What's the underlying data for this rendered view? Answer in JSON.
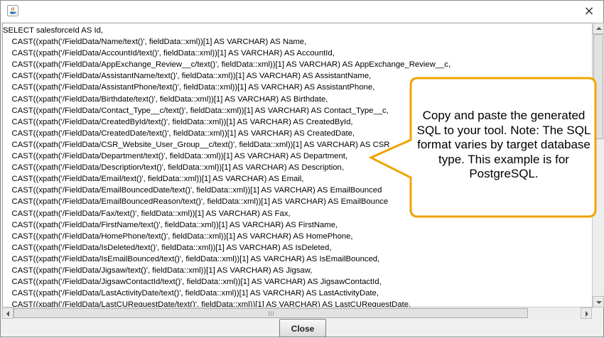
{
  "window": {
    "close_glyph": "×",
    "app_icon": "java-icon"
  },
  "editor": {
    "lines": [
      "SELECT salesforceId AS Id,",
      "    CAST((xpath('/FieldData/Name/text()', fieldData::xml))[1] AS VARCHAR) AS Name,",
      "    CAST((xpath('/FieldData/AccountId/text()', fieldData::xml))[1] AS VARCHAR) AS AccountId,",
      "    CAST((xpath('/FieldData/AppExchange_Review__c/text()', fieldData::xml))[1] AS VARCHAR) AS AppExchange_Review__c,",
      "    CAST((xpath('/FieldData/AssistantName/text()', fieldData::xml))[1] AS VARCHAR) AS AssistantName,",
      "    CAST((xpath('/FieldData/AssistantPhone/text()', fieldData::xml))[1] AS VARCHAR) AS AssistantPhone,",
      "    CAST((xpath('/FieldData/Birthdate/text()', fieldData::xml))[1] AS VARCHAR) AS Birthdate,",
      "    CAST((xpath('/FieldData/Contact_Type__c/text()', fieldData::xml))[1] AS VARCHAR) AS Contact_Type__c,",
      "    CAST((xpath('/FieldData/CreatedById/text()', fieldData::xml))[1] AS VARCHAR) AS CreatedById,",
      "    CAST((xpath('/FieldData/CreatedDate/text()', fieldData::xml))[1] AS VARCHAR) AS CreatedDate,",
      "    CAST((xpath('/FieldData/CSR_Website_User_Group__c/text()', fieldData::xml))[1] AS VARCHAR) AS CSR_",
      "    CAST((xpath('/FieldData/Department/text()', fieldData::xml))[1] AS VARCHAR) AS Department,",
      "    CAST((xpath('/FieldData/Description/text()', fieldData::xml))[1] AS VARCHAR) AS Description,",
      "    CAST((xpath('/FieldData/Email/text()', fieldData::xml))[1] AS VARCHAR) AS Email,",
      "    CAST((xpath('/FieldData/EmailBouncedDate/text()', fieldData::xml))[1] AS VARCHAR) AS EmailBounced",
      "    CAST((xpath('/FieldData/EmailBouncedReason/text()', fieldData::xml))[1] AS VARCHAR) AS EmailBounce",
      "    CAST((xpath('/FieldData/Fax/text()', fieldData::xml))[1] AS VARCHAR) AS Fax,",
      "    CAST((xpath('/FieldData/FirstName/text()', fieldData::xml))[1] AS VARCHAR) AS FirstName,",
      "    CAST((xpath('/FieldData/HomePhone/text()', fieldData::xml))[1] AS VARCHAR) AS HomePhone,",
      "    CAST((xpath('/FieldData/IsDeleted/text()', fieldData::xml))[1] AS VARCHAR) AS IsDeleted,",
      "    CAST((xpath('/FieldData/IsEmailBounced/text()', fieldData::xml))[1] AS VARCHAR) AS IsEmailBounced,",
      "    CAST((xpath('/FieldData/Jigsaw/text()', fieldData::xml))[1] AS VARCHAR) AS Jigsaw,",
      "    CAST((xpath('/FieldData/JigsawContactId/text()', fieldData::xml))[1] AS VARCHAR) AS JigsawContactId,",
      "    CAST((xpath('/FieldData/LastActivityDate/text()', fieldData::xml))[1] AS VARCHAR) AS LastActivityDate,",
      "    CAST((xpath('/FieldData/LastCURequestDate/text()', fieldData::xml))[1] AS VARCHAR) AS LastCURequestDate,"
    ]
  },
  "callout": {
    "text": "Copy and paste the generated SQL to your tool. Note: The SQL format varies by target database type. This example is for PostgreSQL.",
    "border_color": "#f0a400",
    "fill_color": "#ffffff"
  },
  "buttons": {
    "close_label": "Close"
  }
}
